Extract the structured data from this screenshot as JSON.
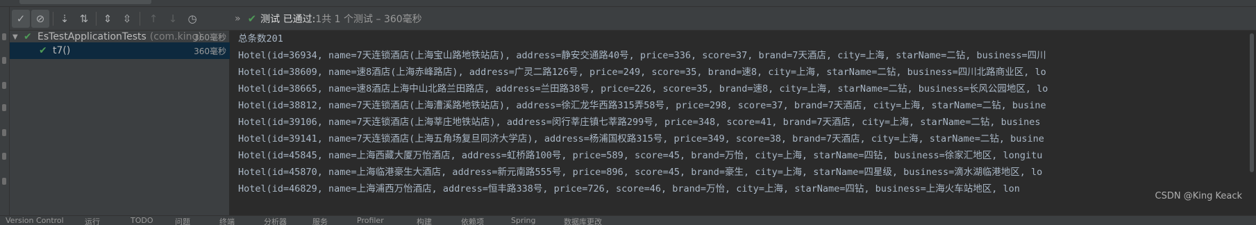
{
  "toolbar": {
    "buttons": [
      {
        "icon": "check-icon",
        "glyph": "✓"
      },
      {
        "icon": "stop-icon",
        "glyph": "⊘"
      },
      {
        "icon": "sort-alpha-icon",
        "glyph": "⇣"
      },
      {
        "icon": "sort-duration-icon",
        "glyph": "⇅"
      },
      {
        "icon": "expand-all-icon",
        "glyph": "⇕"
      },
      {
        "icon": "collapse-all-icon",
        "glyph": "⇳"
      },
      {
        "icon": "arrow-up-icon",
        "glyph": "↑"
      },
      {
        "icon": "arrow-down-icon",
        "glyph": "↓"
      },
      {
        "icon": "history-icon",
        "glyph": "◷"
      }
    ]
  },
  "status": {
    "chevron": "»",
    "check": "✔",
    "label": "测试 已通过:",
    "detail": " 1共 1 个测试 – 360毫秒"
  },
  "tree": {
    "suite": {
      "name": "EsTestApplicationTests",
      "pkg": "(com.king)",
      "time": "360毫秒"
    },
    "test": {
      "name": "t7()",
      "time": "360毫秒"
    }
  },
  "console": {
    "lines": [
      "总条数201",
      "Hotel(id=36934, name=7天连锁酒店(上海宝山路地铁站店), address=静安交通路40号, price=336, score=37, brand=7天酒店, city=上海, starName=二钻, business=四川",
      "Hotel(id=38609, name=速8酒店(上海赤峰路店), address=广灵二路126号, price=249, score=35, brand=速8, city=上海, starName=二钻, business=四川北路商业区, lo",
      "Hotel(id=38665, name=速8酒店上海中山北路兰田路店, address=兰田路38号, price=226, score=35, brand=速8, city=上海, starName=二钻, business=长风公园地区, lo",
      "Hotel(id=38812, name=7天连锁酒店(上海漕溪路地铁站店), address=徐汇龙华西路315弄58号, price=298, score=37, brand=7天酒店, city=上海, starName=二钻, busine",
      "Hotel(id=39106, name=7天连锁酒店(上海莘庄地铁站店), address=闵行莘庄镇七莘路299号, price=348, score=41, brand=7天酒店, city=上海, starName=二钻, busines",
      "Hotel(id=39141, name=7天连锁酒店(上海五角场复旦同济大学店), address=杨浦国权路315号, price=349, score=38, brand=7天酒店, city=上海, starName=二钻, busine",
      "Hotel(id=45845, name=上海西藏大厦万怡酒店, address=虹桥路100号, price=589, score=45, brand=万怡, city=上海, starName=四钻, business=徐家汇地区, longitu",
      "Hotel(id=45870, name=上海临港豪生大酒店, address=新元南路555号, price=896, score=45, brand=豪生, city=上海, starName=四星级, business=滴水湖临港地区, lo",
      "Hotel(id=46829, name=上海浦西万怡酒店, address=恒丰路338号, price=726, score=46, brand=万怡, city=上海, starName=四钻, business=上海火车站地区, lon"
    ]
  },
  "watermark": "CSDN @King Keack",
  "bottom_tabs": [
    "Version Control",
    "运行",
    "TODO",
    "问题",
    "终端",
    "分析器",
    "服务",
    "Profiler",
    "构建",
    "依赖项",
    "Spring",
    "数据库更改"
  ]
}
